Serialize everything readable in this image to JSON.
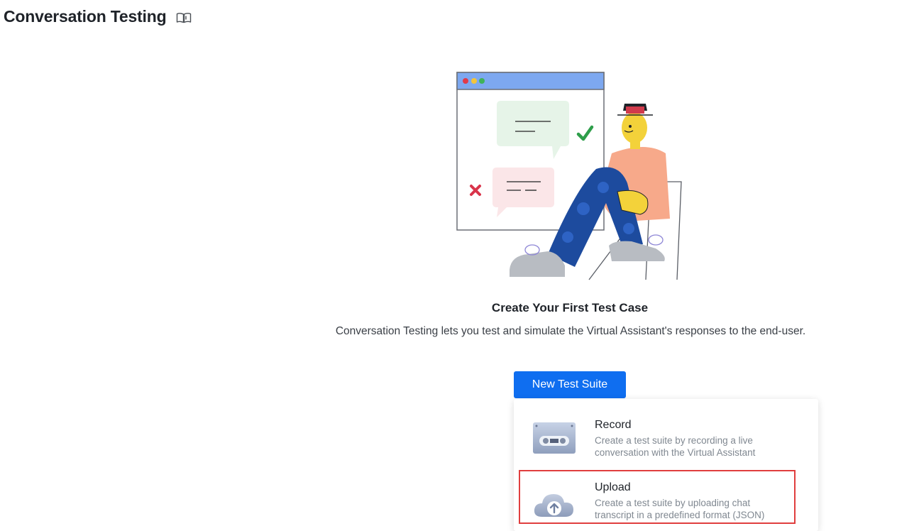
{
  "header": {
    "title": "Conversation Testing",
    "docs_icon": "book-icon"
  },
  "empty_state": {
    "title": "Create Your First Test Case",
    "description": "Conversation Testing lets you test and simulate the Virtual Assistant's responses to the end-user.",
    "button_label": "New Test Suite"
  },
  "menu": {
    "options": [
      {
        "label": "Record",
        "description": "Create a test suite by recording a live conversation with the Virtual Assistant",
        "icon": "cassette-icon"
      },
      {
        "label": "Upload",
        "description": "Create a test suite by uploading chat transcript in a predefined format (JSON)",
        "icon": "cloud-upload-icon",
        "highlighted": true
      }
    ]
  },
  "colors": {
    "primary": "#0f6ef0",
    "highlight": "#e03e3e",
    "check": "#2e9e4a",
    "cross": "#d9344a"
  }
}
